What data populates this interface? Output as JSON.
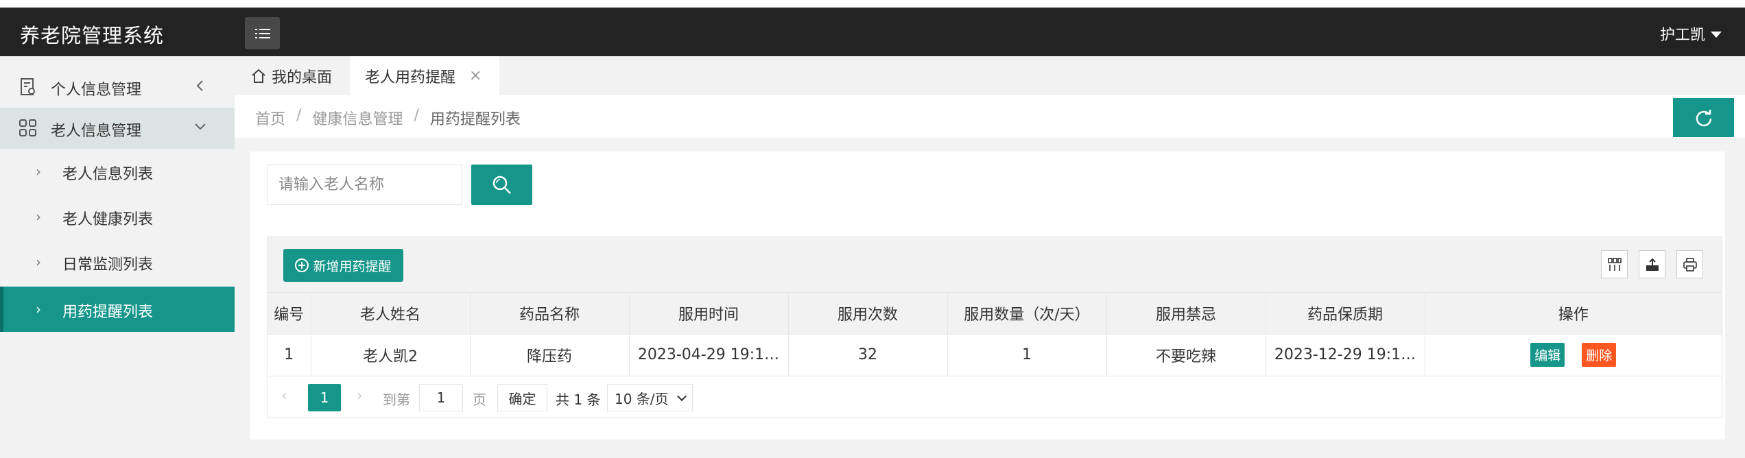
{
  "header": {
    "app_title": "养老院管理系统",
    "user_name": "护工凯"
  },
  "sidebar": {
    "groups": [
      {
        "label": "个人信息管理",
        "icon": "profile-doc-icon",
        "expanded": false
      },
      {
        "label": "老人信息管理",
        "icon": "grid-apps-icon",
        "expanded": true
      }
    ],
    "items": [
      {
        "label": "老人信息列表"
      },
      {
        "label": "老人健康列表"
      },
      {
        "label": "日常监测列表"
      },
      {
        "label": "用药提醒列表",
        "active": true
      }
    ]
  },
  "tabs": {
    "home": "我的桌面",
    "current": "老人用药提醒"
  },
  "breadcrumb": {
    "home": "首页",
    "section": "健康信息管理",
    "page": "用药提醒列表",
    "separator": "/"
  },
  "search": {
    "placeholder": "请输入老人名称"
  },
  "toolbar": {
    "add_label": "新增用药提醒"
  },
  "table": {
    "headers": {
      "id": "编号",
      "elder": "老人姓名",
      "drug": "药品名称",
      "time": "服用时间",
      "times": "服用次数",
      "qty": "服用数量（次/天）",
      "taboo": "服用禁忌",
      "expiry": "药品保质期",
      "ops": "操作"
    },
    "rows": [
      {
        "id": "1",
        "elder": "老人凯2",
        "drug": "降压药",
        "time": "2023-04-29 19:1…",
        "times": "32",
        "qty": "1",
        "taboo": "不要吃辣",
        "expiry": "2023-12-29 19:1…",
        "edit": "编辑",
        "delete": "删除"
      }
    ]
  },
  "pagination": {
    "current_page": "1",
    "goto_label": "到第",
    "goto_value": "1",
    "page_suffix": "页",
    "confirm": "确定",
    "total": "共 1 条",
    "page_size": "10 条/页"
  },
  "colors": {
    "accent": "#16968a",
    "danger": "#ff5722",
    "topbar": "#232323",
    "sidebar": "#f2f2f2"
  }
}
